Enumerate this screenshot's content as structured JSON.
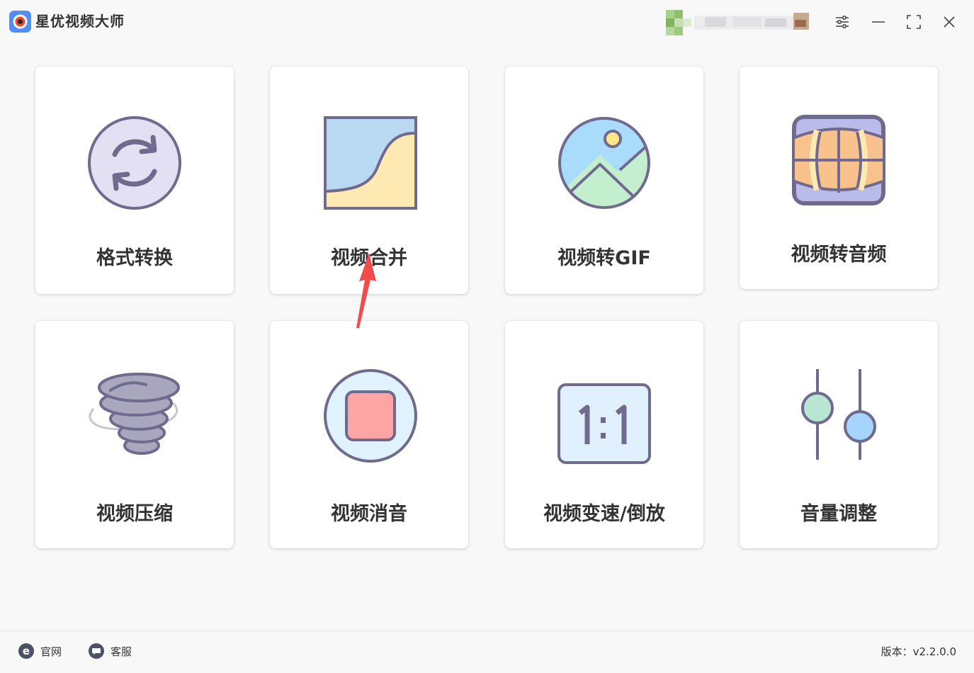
{
  "app": {
    "title": "星优视频大师",
    "logo_icon": "camera-lens-icon"
  },
  "window_controls": {
    "settings_icon": "sliders-icon",
    "minimize_icon": "minimize-icon",
    "maximize_icon": "maximize-icon",
    "close_icon": "close-icon"
  },
  "tools": [
    {
      "label": "格式转换",
      "icon": "refresh-circle-icon"
    },
    {
      "label": "视频合并",
      "icon": "merge-curve-icon"
    },
    {
      "label": "视频转GIF",
      "icon": "landscape-image-icon"
    },
    {
      "label": "视频转音频",
      "icon": "panorama-film-icon"
    },
    {
      "label": "视频压缩",
      "icon": "tornado-icon"
    },
    {
      "label": "视频消音",
      "icon": "stop-square-icon"
    },
    {
      "label": "视频变速/倒放",
      "icon": "aspect-ratio-icon"
    },
    {
      "label": "音量调整",
      "icon": "volume-sliders-icon"
    }
  ],
  "footer": {
    "website_label": "官网",
    "support_label": "客服",
    "version_text": "版本：v2.2.0.0"
  },
  "colors": {
    "stroke": "#6f6a8e",
    "refresh_fill": "#e3e0f3",
    "merge_blue": "#b9d9f2",
    "merge_yellow": "#ffe9b3",
    "gif_sky": "#a9dcfb",
    "gif_grass": "#c4efcf",
    "gif_sun": "#fde68a",
    "panorama_blue": "#b9bce8",
    "panorama_orange": "#f9c28c",
    "tornado_gray": "#a9a7bd",
    "stop_circle": "#dff2fd",
    "stop_square": "#fda4a4",
    "ratio_fill": "#e0f1fd",
    "knob_green": "#b9e6d2",
    "knob_blue": "#a6d5fb",
    "arrow_red": "#f24b4b"
  }
}
